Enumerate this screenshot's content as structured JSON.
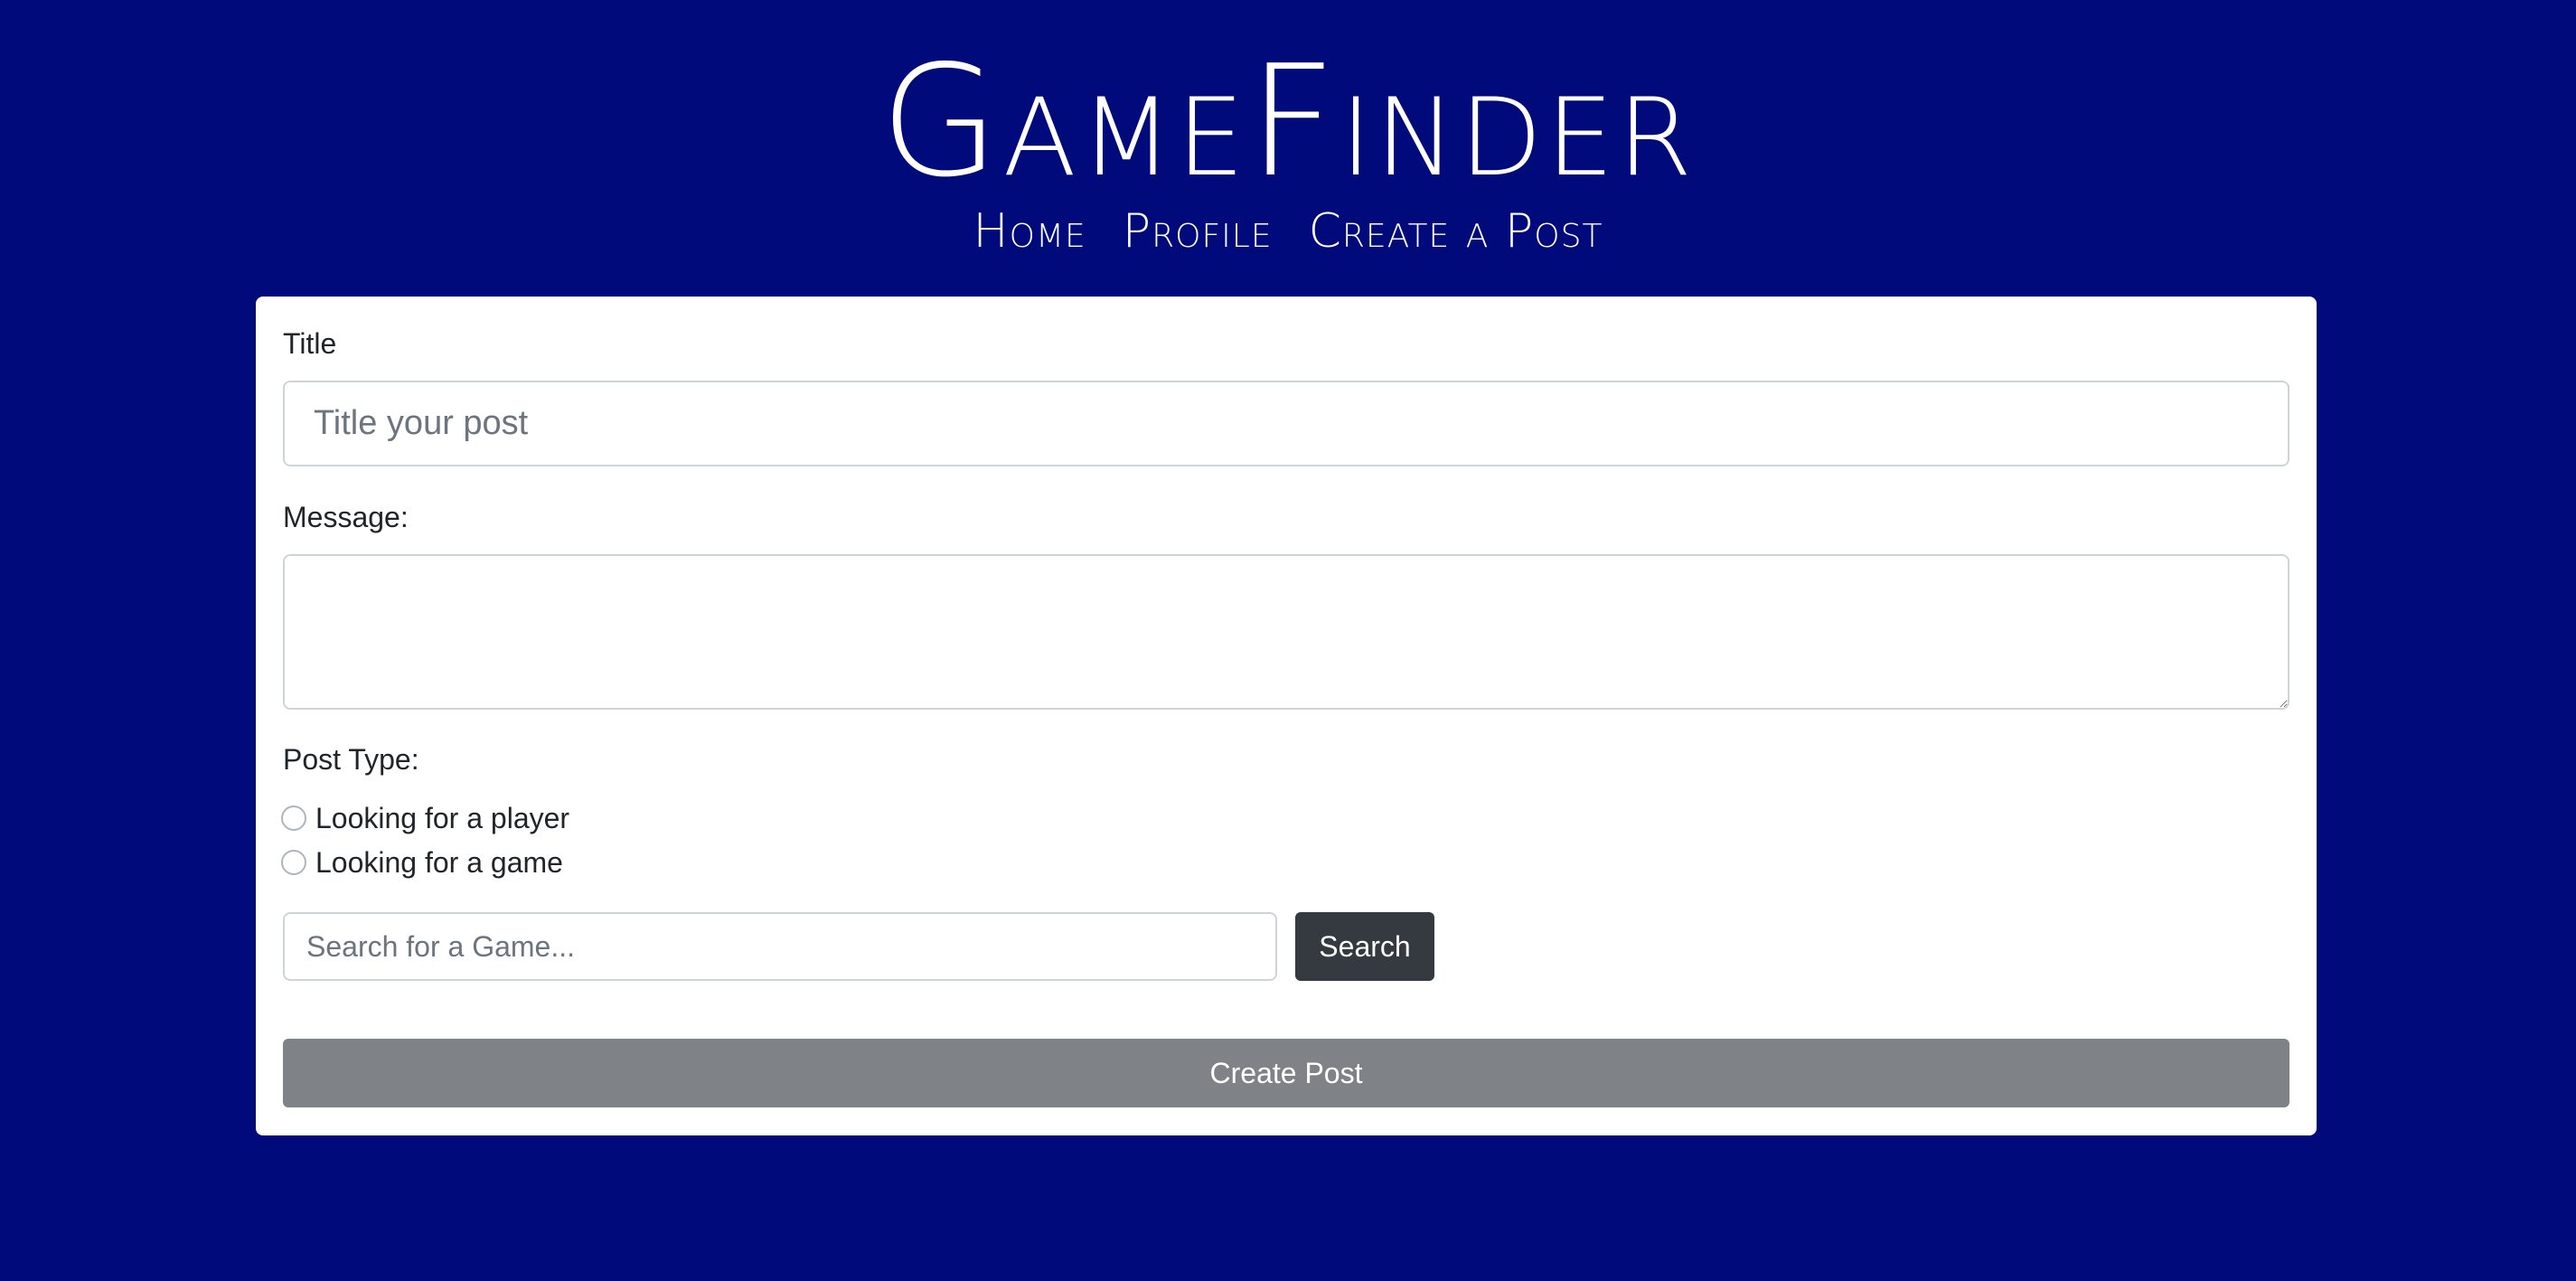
{
  "header": {
    "brand": "GameFinder",
    "nav": [
      {
        "label": "Home"
      },
      {
        "label": "Profile"
      },
      {
        "label": "Create a Post"
      }
    ]
  },
  "form": {
    "title_label": "Title",
    "title_placeholder": "Title your post",
    "title_value": "",
    "message_label": "Message:",
    "message_value": "",
    "post_type_label": "Post Type:",
    "post_type_options": [
      {
        "label": "Looking for a player",
        "selected": false
      },
      {
        "label": "Looking for a game",
        "selected": false
      }
    ],
    "search_placeholder": "Search for a Game...",
    "search_value": "",
    "search_button_label": "Search",
    "create_button_label": "Create Post"
  },
  "colors": {
    "background": "#000a7b",
    "card": "#ffffff",
    "search_button": "#343a40",
    "create_button": "#7f8387"
  }
}
